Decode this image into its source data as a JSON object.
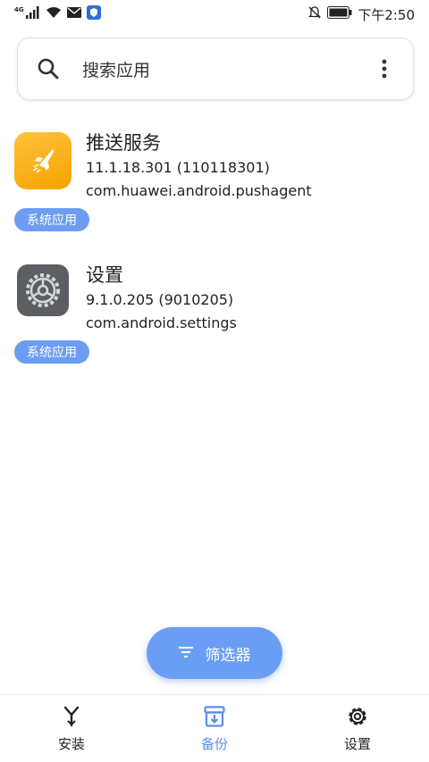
{
  "status_bar": {
    "network": "4G",
    "time": "下午2:50"
  },
  "search": {
    "placeholder": "搜索应用"
  },
  "apps": [
    {
      "name": "推送服务",
      "version": "11.1.18.301 (110118301)",
      "package": "com.huawei.android.pushagent",
      "badge": "系统应用",
      "icon": "rocket-icon"
    },
    {
      "name": "设置",
      "version": "9.1.0.205 (9010205)",
      "package": "com.android.settings",
      "badge": "系统应用",
      "icon": "settings-gear-icon"
    }
  ],
  "fab": {
    "label": "筛选器",
    "icon": "filter-icon"
  },
  "bottom_nav": {
    "items": [
      {
        "label": "安装",
        "icon": "install-icon",
        "active": false
      },
      {
        "label": "备份",
        "icon": "backup-icon",
        "active": true
      },
      {
        "label": "设置",
        "icon": "gear-icon",
        "active": false
      }
    ]
  },
  "colors": {
    "accent": "#6a9ef4",
    "badge": "#6c9df2",
    "active_nav": "#5a8fe6"
  }
}
